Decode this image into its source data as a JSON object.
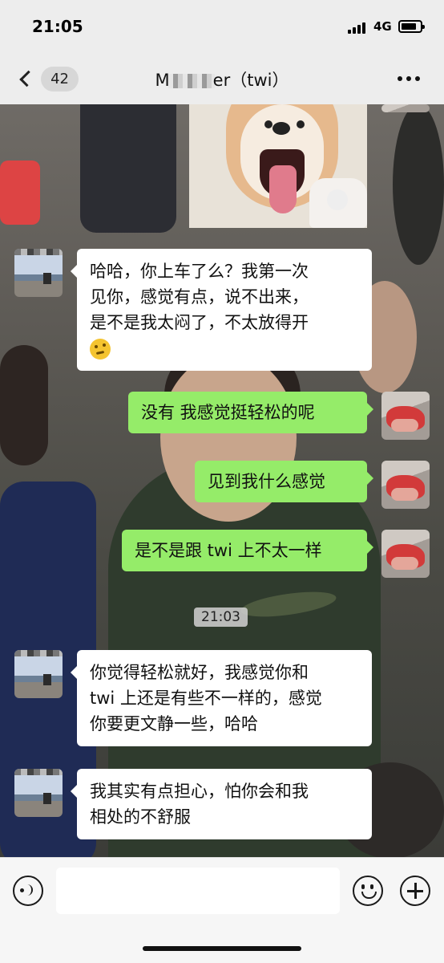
{
  "status_bar": {
    "time": "21:05",
    "network": "4G"
  },
  "header": {
    "back_label": "",
    "unread_count": "42",
    "title_prefix": "M",
    "title_suffix": "er（twi）"
  },
  "messages": [
    {
      "side": "in",
      "lines": [
        "哈哈，你上车了么？我第一次",
        "见你，感觉有点，说不出来，",
        "是不是我太闷了，不太放得开"
      ],
      "emoji": "thinking-face"
    },
    {
      "side": "out",
      "lines": [
        "没有 我感觉挺轻松的呢"
      ]
    },
    {
      "side": "out",
      "lines": [
        "见到我什么感觉"
      ]
    },
    {
      "side": "out",
      "lines": [
        "是不是跟 twi 上不太一样"
      ]
    },
    {
      "side": "in",
      "lines": [
        "你觉得轻松就好，我感觉你和",
        "twi 上还是有些不一样的，感觉",
        "你要更文静一些，哈哈"
      ]
    },
    {
      "side": "in",
      "lines": [
        "我其实有点担心，怕你会和我",
        "相处的不舒服"
      ]
    }
  ],
  "timestamp": "21:03",
  "input": {
    "placeholder": ""
  },
  "icons": {
    "back": "chevron-left-icon",
    "more": "more-dots-icon",
    "voice": "voice-icon",
    "emoji": "smiley-icon",
    "plus": "plus-icon"
  },
  "colors": {
    "outgoing_bubble": "#95ec69",
    "incoming_bubble": "#ffffff",
    "bar_background": "#ededed"
  }
}
